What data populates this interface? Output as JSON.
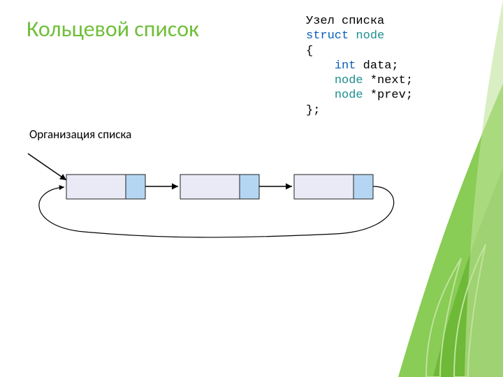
{
  "title": "Кольцевой список",
  "subheader": "Организация списка",
  "code": {
    "label": "Узел списка",
    "struct_kw": "struct",
    "struct_name": "node",
    "open_brace": "{",
    "line_int_kw": "int",
    "line_int_rest": " data;",
    "line_next_type": "node",
    "line_next_rest": " *next;",
    "line_prev_type": "node",
    "line_prev_rest": " *prev;",
    "close_brace": "};"
  },
  "diagram": {
    "nodes": 3,
    "colors": {
      "node_body": "#e9eaf5",
      "node_tail": "#b4d6f2",
      "node_stroke": "#222"
    }
  }
}
